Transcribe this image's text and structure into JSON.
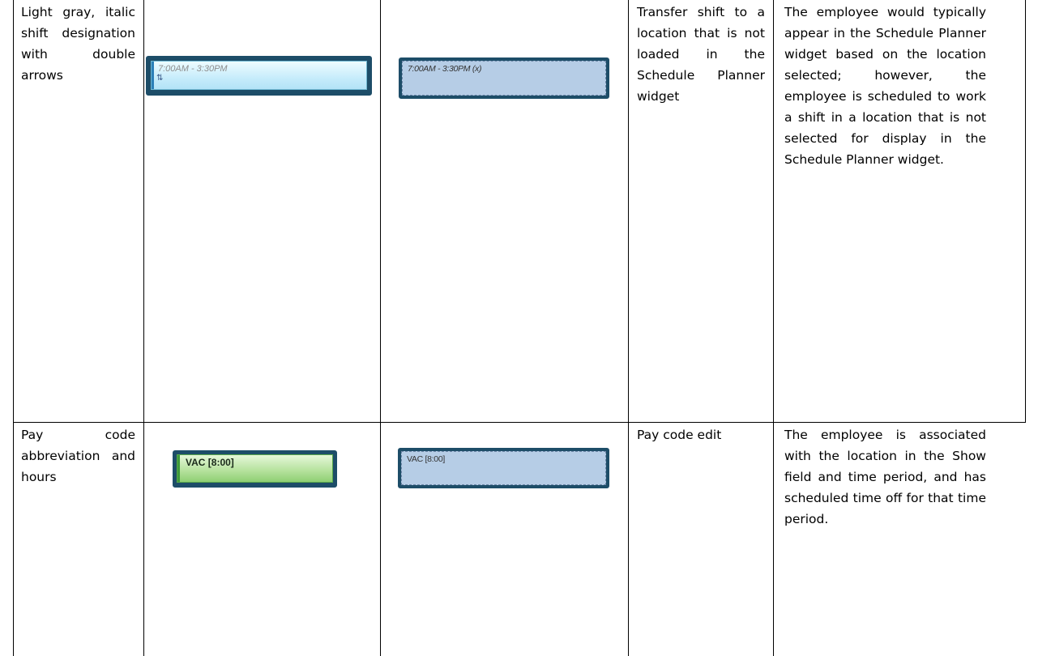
{
  "rows": [
    {
      "indicator": "Light gray, italic shift designation with double arrows",
      "widget_shift": {
        "text": "7:00AM - 3:30PM",
        "arrows": "⇅"
      },
      "planner_shift": {
        "text": "7:00AM - 3:30PM (x)"
      },
      "meaning": "Transfer shift to a location that is not loaded in the Schedule Planner widget",
      "description": "The employee would typically appear in the Schedule Planner widget based on the location selected; however, the employee is scheduled to work a shift in a location that is not selected for display in the Schedule Planner widget."
    },
    {
      "indicator": "Pay code abbreviation and hours",
      "widget_shift": {
        "text": "VAC [8:00]"
      },
      "planner_shift": {
        "text": "VAC [8:00]"
      },
      "meaning": "Pay code edit",
      "description": "The employee is associated with the location in the Show field and time period, and has scheduled time off for that time period."
    }
  ],
  "colors": {
    "frame": "#1d4d68",
    "transfer_bar": "#c6ecfb",
    "planner_bar": "#b6cde6",
    "paycode_bar": "#b8e3a0"
  }
}
